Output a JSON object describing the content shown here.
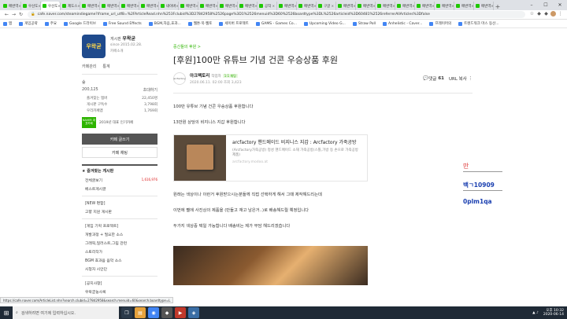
{
  "browser": {
    "tabs": [
      {
        "label": "메번역",
        "active": false
      },
      {
        "label": "우산도",
        "active": false
      },
      {
        "label": "우산도",
        "active": true
      },
      {
        "label": "제도스",
        "active": false
      },
      {
        "label": "메번역",
        "active": false
      },
      {
        "label": "메번역",
        "active": false
      },
      {
        "label": "메번역",
        "active": false
      },
      {
        "label": "메번역",
        "active": false
      },
      {
        "label": "네이버",
        "active": false
      },
      {
        "label": "메번역",
        "active": false
      },
      {
        "label": "메번역",
        "active": false
      },
      {
        "label": "메번역",
        "active": false
      },
      {
        "label": "메번역",
        "active": false
      },
      {
        "label": "공작",
        "active": false
      },
      {
        "label": "메번역",
        "active": false
      },
      {
        "label": "메번역",
        "active": false
      },
      {
        "label": "구글",
        "active": false
      },
      {
        "label": "메번역",
        "active": false
      },
      {
        "label": "메번역",
        "active": false
      },
      {
        "label": "메번역",
        "active": false
      },
      {
        "label": "메번역",
        "active": false
      },
      {
        "label": "메번역",
        "active": false
      },
      {
        "label": "메번역",
        "active": false
      },
      {
        "label": "메번역",
        "active": false
      },
      {
        "label": "메번역",
        "active": false
      }
    ],
    "new_tab": "+",
    "url": "cafe.naver.com/steamindiegame?iframe_url_utf8=%2FArticleRead.nhn%253Fclubid%3D27842958%2526page%3D1%2526menuid%3D60%2526boardtype%3DL%2526articleid%3D60481%2526referrerAllArticles%3Dfalse",
    "bookmarks": [
      "앱",
      "게임공략",
      "주요",
      "Google 드라이브",
      "Free Sound Effects",
      "BGM,자음,효과...",
      "웹툰·북·웹토",
      "세이버 프로젝트",
      "GAMS - Games Co...",
      "Upcoming Video G...",
      "Straw Poll",
      "Anhelistic - Caver...",
      "프레이머의",
      "트렌드워크 마스 동산..."
    ]
  },
  "sidebar": {
    "cafe_logo_text": "우왁굳",
    "manager_label": "게시판",
    "manager_name": "우왁굳",
    "since": "since 2015.02.28.",
    "cafe_intro": "카페소개",
    "links": [
      "카페관리",
      "통계"
    ],
    "level": "숲",
    "member_count": "200,125",
    "invite": "초대하기",
    "stats": [
      {
        "label": "즐겨찾는 멤버",
        "value": "22,450명"
      },
      {
        "label": "게시판 구독수",
        "value": "3,798회"
      },
      {
        "label": "우리카페앱",
        "value": "1,769회"
      }
    ],
    "badge_text": "NAVER 대표카페",
    "badge_desc": "2019년 대표 인기카페",
    "write_button": "카페 글쓰기",
    "chat_button": "카페 채팅",
    "menu_head": "즐겨찾는 게시판",
    "menu_items": [
      {
        "label": "전체글보기",
        "count": "1,616,976"
      },
      {
        "label": "베스트게시글",
        "count": ""
      }
    ],
    "section_new": "[NEW 편함]",
    "new_items": [
      "고향 지원 게시판"
    ],
    "section_project": "[게임 기획 프로젝트]",
    "project_items": [
      "개발과정 + 필요한 소스",
      "그래픽,일러스트,그림 관련",
      "스토리작가",
      "BGM 효과음 음악 소스",
      "시청자 시안단"
    ],
    "section_notice": "[공지사항]",
    "notice_items": [
      "우왁굳농사록"
    ]
  },
  "article": {
    "breadcrumb": "중신들의 후원 >",
    "title": "[후원]100만 유튜브 기념 건콘 우승상품 후원",
    "author_avatar": "arcfactory",
    "author_name": "아크팩토리",
    "author_grade": "작업자",
    "author_level": "1:1 채팅",
    "date": "2020.06.11. 02:00  조회 3,423",
    "comment_label": "댓글",
    "comment_count": "61",
    "url_copy": "URL 복사",
    "para1": "100만 유튜브 기념 건콘 우승상품 후원합니다",
    "para2": "13만원 상당의 비지니스 지갑 후원합니다",
    "link_title": "arcfactory 핸드메이드 비지니스 지갑 : Arcfactory 가죽공방",
    "link_desc": "(Arcfactory가죽공방) 정성 핸드메이드 소재 가죽공방(스톨,가방 등 손으로 가죽공방제품)",
    "link_url": "arcfactory.modoo.at",
    "para3": "원래는 색상이나 이런거 후원받으시는분들께 직접 선택하게 해서 그때 제작해드리는데",
    "para4": "이번에 펠에 사진상의 제품을 (만들고 재고 남은거..)로 배송해드릴 예정입니다",
    "para5": "두가지 색상중 택일 가능합니다 배송비는 제가 부담 해드리겠습니다"
  },
  "overlay": {
    "line1": "만",
    "line2": "백ㄱ10909",
    "line3": "0plm1qa"
  },
  "status_url": "https://cafe.naver.com/ArticleList.nhn?search.clubid=27842958&search.menuid=60&search.boardtype=L",
  "taskbar": {
    "search_placeholder": "검색하려면 여기에 입력하십시오.",
    "time": "오후 10:32",
    "date": "2020-06-14"
  },
  "colors": {
    "naver_green": "#2db400",
    "sidebar_dark_button": "#555555",
    "taskbar_bg": "#1f2a36"
  }
}
